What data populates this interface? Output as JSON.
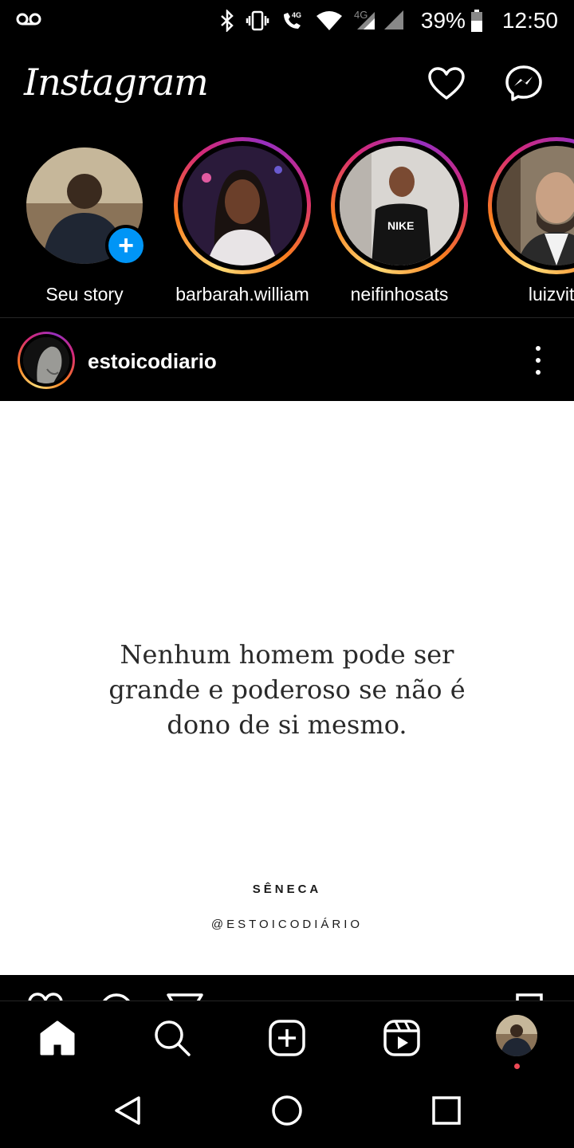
{
  "status_bar": {
    "battery": "39%",
    "time": "12:50",
    "network": "4G",
    "icons": [
      "voicemail-icon",
      "bluetooth-icon",
      "vibrate-icon",
      "volte-call-icon",
      "wifi-icon",
      "signal-icon",
      "battery-icon"
    ]
  },
  "header": {
    "logo": "Instagram",
    "icons": [
      "heart-icon",
      "messenger-icon"
    ]
  },
  "stories": [
    {
      "name": "Seu story",
      "own": true
    },
    {
      "name": "barbarah.william",
      "own": false
    },
    {
      "name": "neifinhosats",
      "own": false
    },
    {
      "name": "luizvita",
      "own": false
    }
  ],
  "post": {
    "username": "estoicodiario",
    "quote_lines": [
      "Nenhum homem pode ser",
      "grande e poderoso se não é",
      "dono de si mesmo."
    ],
    "author": "SÊNECA",
    "handle": "@ESTOICODIÁRIO"
  },
  "bottom_nav": {
    "items": [
      "home-icon",
      "search-icon",
      "create-icon",
      "reels-icon",
      "profile-avatar"
    ]
  },
  "system_nav": {
    "items": [
      "back-icon",
      "home-circle-icon",
      "recents-icon"
    ]
  },
  "colors": {
    "background": "#000000",
    "accent_blue": "#0095f6",
    "notification_red": "#ed4956",
    "story_gradient": [
      "#feda75",
      "#fa7e1e",
      "#d62976",
      "#962fbf"
    ]
  }
}
